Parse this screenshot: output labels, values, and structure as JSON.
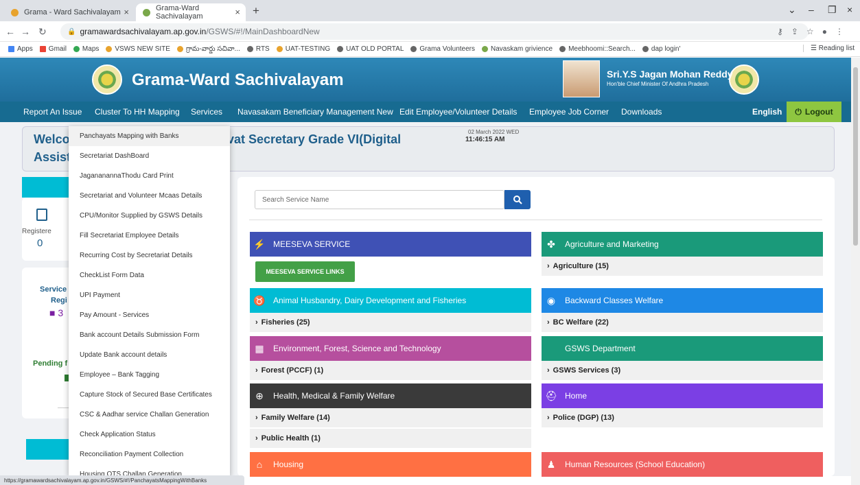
{
  "browser": {
    "tabs": [
      {
        "title": "Grama - Ward Sachivalayam"
      },
      {
        "title": "Grama-Ward Sachivalayam"
      }
    ],
    "url_domain": "gramawardsachivalayam.ap.gov.in",
    "url_path": "/GSWS/#!/MainDashboardNew",
    "bookmarks": [
      "Apps",
      "Gmail",
      "Maps",
      "VSWS NEW SITE",
      "గ్రామ-వార్డు సచివా...",
      "RTS",
      "UAT-TESTING",
      "UAT OLD PORTAL",
      "Grama Volunteers",
      "Navaskam grivience",
      "Meebhoomi::Search...",
      "dap login'"
    ],
    "reading_list": "Reading list",
    "status_url": "https://gramawardsachivalayam.ap.gov.in/GSWS/#!/PanchayatsMappingWithBanks"
  },
  "header": {
    "title": "Grama-Ward Sachivalayam",
    "cm_name": "Sri.Y.S Jagan Mohan Reddy",
    "cm_designation": "Hon'ble Chief Minister Of Andhra Pradesh"
  },
  "nav": {
    "items": [
      "Report An Issue",
      "Cluster To HH Mapping",
      "Services",
      "Navasakam Beneficiary Management New",
      "Edit Employee/Volunteer Details",
      "Employee Job Corner",
      "Downloads"
    ],
    "language": "English",
    "logout": "Logout"
  },
  "welcome": {
    "line1_start": "Welco",
    "line1_end": "vat Secretary Grade VI(Digital",
    "line2": "Assist",
    "date": "02 March 2022 WED",
    "time": "11:46:15 AM"
  },
  "left": {
    "registered_label": "Registere",
    "registered_value": "0",
    "service_label": "Service",
    "regi_label": "Regi",
    "service_value": "■ 3",
    "pending_label": "Pending f"
  },
  "dropdown": [
    "Panchayats Mapping with Banks",
    "Secretariat DashBoard",
    "JagananannaThodu Card Print",
    "Secretariat and Volunteer Mcaas Details",
    "CPU/Monitor Supplied by GSWS Details",
    "Fill Secretariat Employee Details",
    "Recurring Cost by Secretariat Details",
    "CheckList Form Data",
    "UPI Payment",
    "Pay Amount - Services",
    "Bank account Details Submission Form",
    "Update Bank account details",
    "Employee – Bank Tagging",
    "Capture Stock of Secured Base Certificates",
    "CSC & Aadhar service Challan Generation",
    "Check Application Status",
    "Reconciliation Payment Collection",
    "Housing OTS Challan Generation"
  ],
  "search": {
    "placeholder": "Search Service Name"
  },
  "departments": {
    "meeseva": {
      "title": "MEESEVA SERVICE",
      "button": "MEESEVA SERVICE LINKS",
      "color": "#3f51b5"
    },
    "agri": {
      "title": "Agriculture and Marketing",
      "sub": "Agriculture (15)",
      "color": "#1a9a7a"
    },
    "animal": {
      "title": "Animal Husbandry, Dairy Development and Fisheries",
      "sub": "Fisheries (25)",
      "color": "#00bcd4"
    },
    "bc": {
      "title": "Backward Classes Welfare",
      "sub": "BC Welfare (22)",
      "color": "#1e88e5"
    },
    "env": {
      "title": "Environment, Forest, Science and Technology",
      "sub": "Forest (PCCF) (1)",
      "color": "#b64f9e"
    },
    "gsws": {
      "title": "GSWS Department",
      "sub": "GSWS Services (3)",
      "color": "#1a9a7a"
    },
    "health": {
      "title": "Health, Medical & Family Welfare",
      "sub1": "Family Welfare (14)",
      "sub2": "Public Health (1)",
      "color": "#3a3a3a"
    },
    "home": {
      "title": "Home",
      "sub": "Police (DGP) (13)",
      "color": "#7b3fe4"
    },
    "housing": {
      "title": "Housing",
      "color": "#ff7043"
    },
    "hr": {
      "title": "Human Resources (School Education)",
      "color": "#ef5f5f"
    }
  }
}
